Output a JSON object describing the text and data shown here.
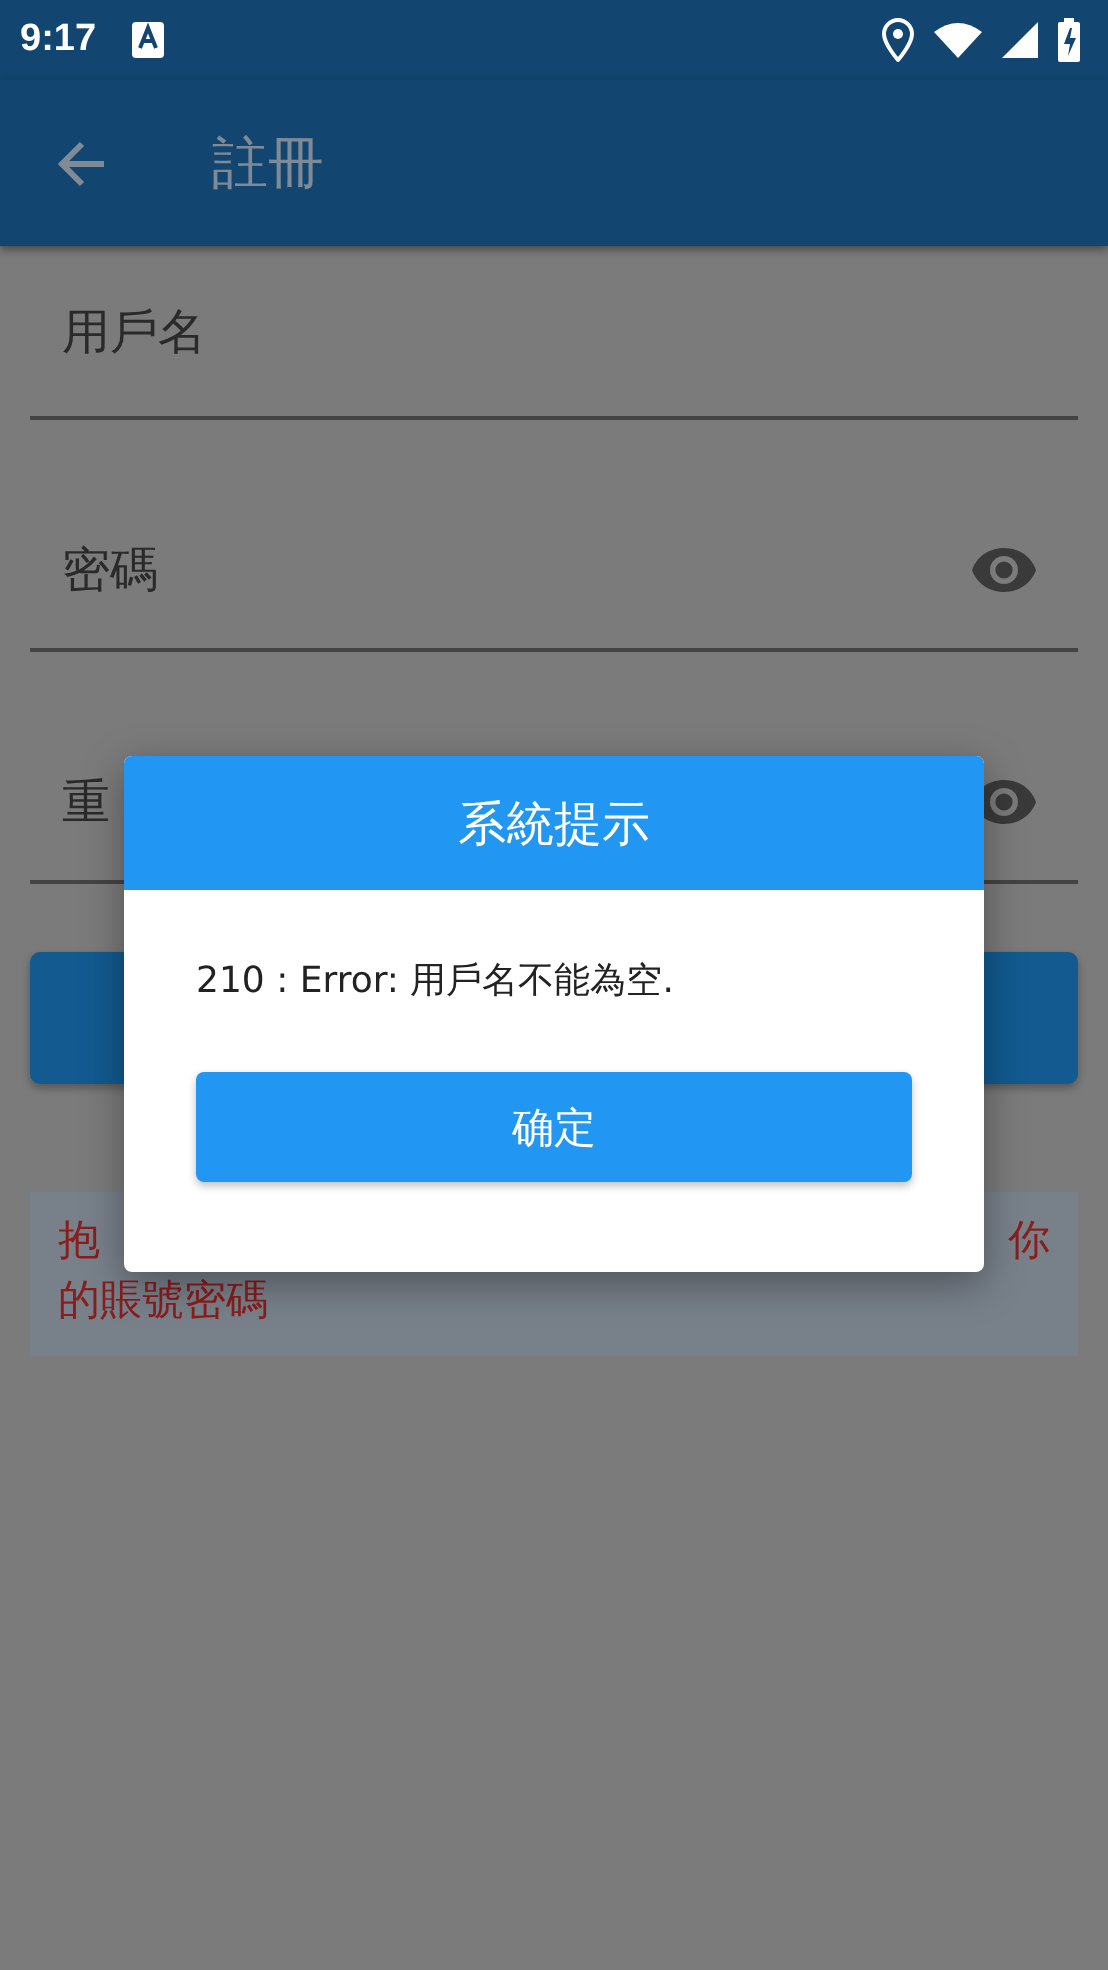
{
  "status_bar": {
    "time": "9:17"
  },
  "app_bar": {
    "title": "註冊"
  },
  "fields": [
    {
      "label": "用戶名",
      "kind": "text"
    },
    {
      "label": "密碼",
      "kind": "password"
    },
    {
      "label": "重",
      "kind": "password"
    }
  ],
  "notice": {
    "line_1_start": "抱",
    "line_1_end": "你",
    "line_2": "的賬號密碼"
  },
  "dialog": {
    "title": "系統提示",
    "message": "210 : Error: 用戶名不能為空.",
    "button": "确定"
  }
}
